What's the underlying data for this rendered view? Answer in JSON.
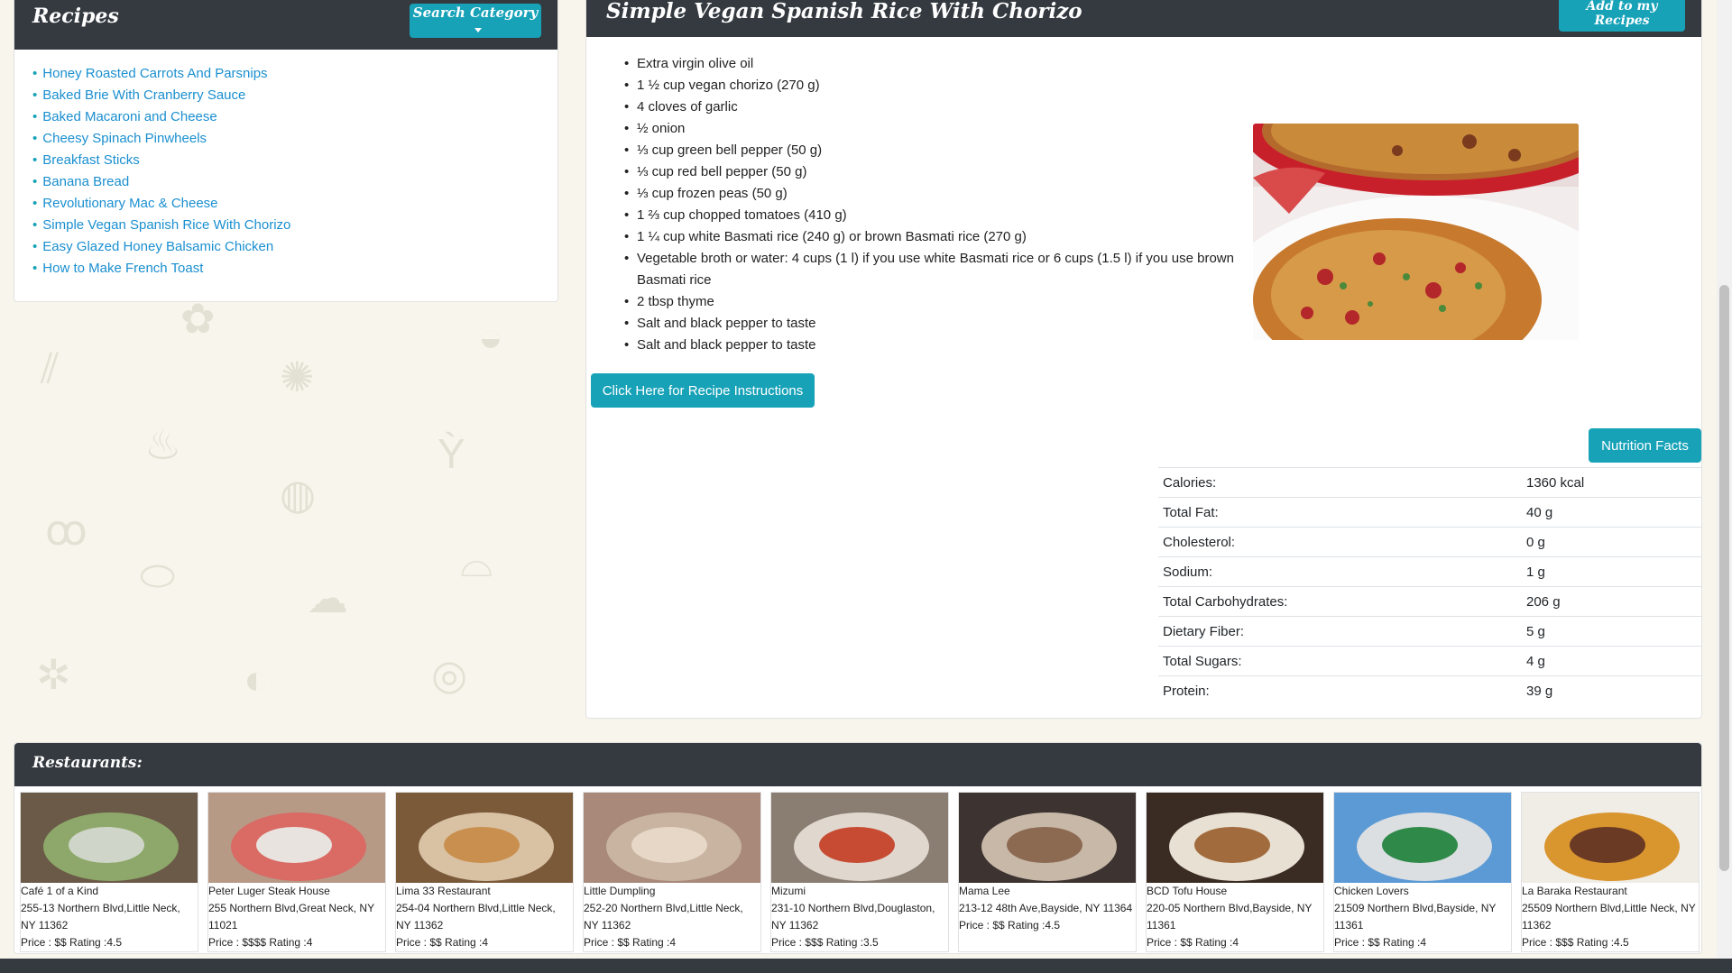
{
  "sidebar": {
    "title": "Recipes",
    "search_category_label": "Search Category",
    "recipes": [
      "Honey Roasted Carrots And Parsnips",
      "Baked Brie With Cranberry Sauce",
      "Baked Macaroni and Cheese",
      "Cheesy Spinach Pinwheels",
      "Breakfast Sticks",
      "Banana Bread",
      "Revolutionary Mac & Cheese",
      "Simple Vegan Spanish Rice With Chorizo",
      "Easy Glazed Honey Balsamic Chicken",
      "How to Make French Toast"
    ]
  },
  "detail": {
    "title": "Simple Vegan Spanish Rice With Chorizo",
    "add_label": "Add to my Recipes",
    "ingredients": [
      "Extra virgin olive oil",
      "1 ½ cup vegan chorizo (270 g)",
      "4 cloves of garlic",
      "½ onion",
      "⅓ cup green bell pepper (50 g)",
      "⅓ cup red bell pepper (50 g)",
      "⅓ cup frozen peas (50 g)",
      "1 ⅔ cup chopped tomatoes (410 g)",
      "1 ¼ cup white Basmati rice (240 g) or brown Basmati rice (270 g)",
      "Vegetable broth or water: 4 cups (1 l) if you use white Basmati rice or 6 cups (1.5 l) if you use brown Basmati rice",
      "2 tbsp thyme",
      "Salt and black pepper to taste",
      "Salt and black pepper to taste"
    ],
    "instructions_label": "Click Here for Recipe Instructions",
    "nutrition_label": "Nutrition Facts",
    "nutrition": [
      {
        "label": "Calories:",
        "value": "1360 kcal"
      },
      {
        "label": "Total Fat:",
        "value": "40 g"
      },
      {
        "label": "Cholesterol:",
        "value": "0 g"
      },
      {
        "label": "Sodium:",
        "value": "1 g"
      },
      {
        "label": "Total Carbohydrates:",
        "value": "206 g"
      },
      {
        "label": "Dietary Fiber:",
        "value": "5 g"
      },
      {
        "label": "Total Sugars:",
        "value": "4 g"
      },
      {
        "label": "Protein:",
        "value": "39 g"
      }
    ]
  },
  "restaurants": {
    "title": "Restaurants:",
    "items": [
      {
        "name": "Café 1 of a Kind",
        "address": "255-13 Northern Blvd,Little Neck, NY 11362",
        "price": "Price : $$ Rating :4.5",
        "palette": [
          "#6b5a48",
          "#cfd5c8",
          "#8da86a"
        ]
      },
      {
        "name": "Peter Luger Steak House",
        "address": "255 Northern Blvd,Great Neck, NY 11021",
        "price": "Price : $$$$ Rating :4",
        "palette": [
          "#b79a86",
          "#e9e3df",
          "#d96a64"
        ]
      },
      {
        "name": "Lima 33 Restaurant",
        "address": "254-04 Northern Blvd,Little Neck, NY 11362",
        "price": "Price : $$ Rating :4",
        "palette": [
          "#7b5a3a",
          "#c98f4e",
          "#d9c2a4"
        ]
      },
      {
        "name": "Little Dumpling",
        "address": "252-20 Northern Blvd,Little Neck, NY 11362",
        "price": "Price : $$ Rating :4",
        "palette": [
          "#a8897a",
          "#e6d7c6",
          "#c9b4a1"
        ]
      },
      {
        "name": "Mizumi",
        "address": "231-10 Northern Blvd,Douglaston, NY 11362",
        "price": "Price : $$$ Rating :3.5",
        "palette": [
          "#8a7d72",
          "#c74b33",
          "#e0d8cf"
        ]
      },
      {
        "name": "Mama Lee",
        "address": "213-12 48th Ave,Bayside, NY 11364",
        "price": "Price : $$ Rating :4.5",
        "palette": [
          "#3d3431",
          "#8c6a52",
          "#c8b8a8"
        ]
      },
      {
        "name": "BCD Tofu House",
        "address": "220-05 Northern Blvd,Bayside, NY 11361",
        "price": "Price : $$ Rating :4",
        "palette": [
          "#3a2c22",
          "#a26b3d",
          "#e8e0d2"
        ]
      },
      {
        "name": "Chicken Lovers",
        "address": "21509 Northern Blvd,Bayside, NY 11361",
        "price": "Price : $$ Rating :4",
        "palette": [
          "#5b9ad4",
          "#2f8a4a",
          "#dcdfe2"
        ]
      },
      {
        "name": "La Baraka Restaurant",
        "address": "25509 Northern Blvd,Little Neck, NY 11362",
        "price": "Price : $$$ Rating :4.5",
        "palette": [
          "#f0ece6",
          "#6b3a24",
          "#d9962f"
        ]
      }
    ]
  },
  "colors": {
    "accent": "#17a2b8",
    "header": "#343a40",
    "link": "#1a8fd0",
    "page_bg": "#f8f6ec"
  }
}
